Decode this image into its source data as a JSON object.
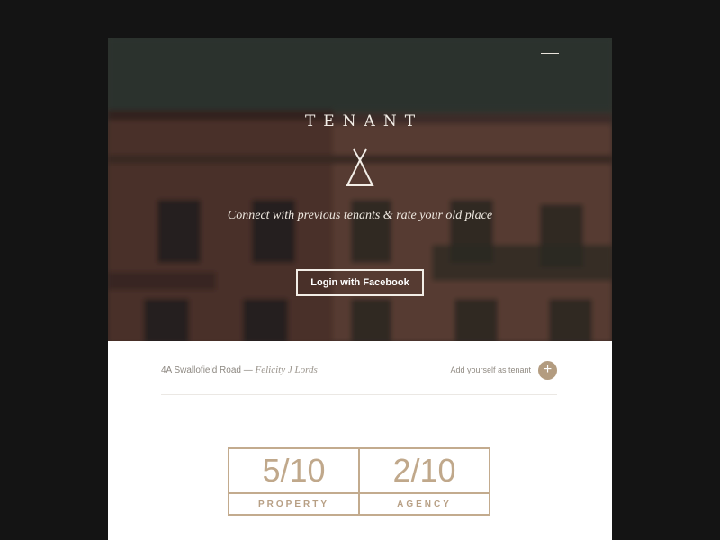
{
  "hero": {
    "brand": "TENANT",
    "tagline": "Connect with previous tenants & rate your old place",
    "login_button": "Login with Facebook",
    "menu_icon": "hamburger-menu-icon",
    "brand_icon": "teepee-icon"
  },
  "listing": {
    "address": "4A Swallofield Road —",
    "landlord": "Felicity J Lords",
    "add_label": "Add yourself as tenant",
    "add_icon": "+"
  },
  "scores": [
    {
      "value": "5/10",
      "label": "PROPERTY"
    },
    {
      "value": "2/10",
      "label": "AGENCY"
    }
  ],
  "colors": {
    "accent": "#c3ab8e",
    "background": "#141414"
  }
}
